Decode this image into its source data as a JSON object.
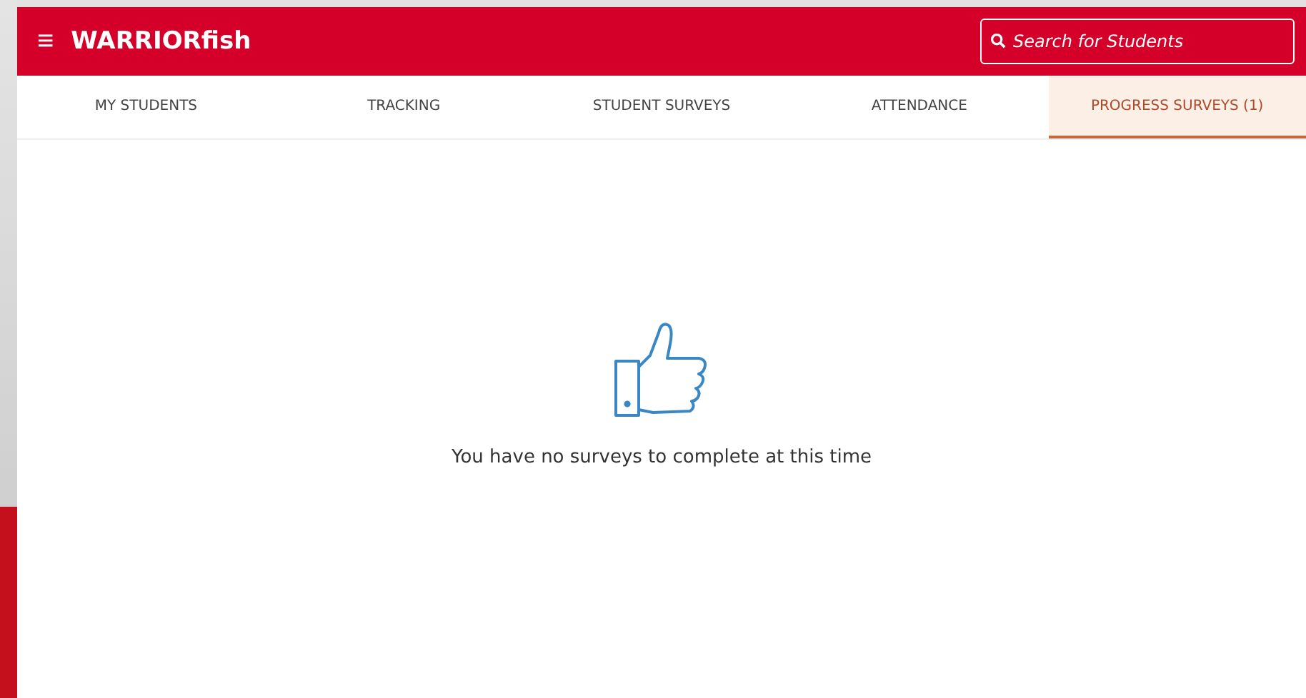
{
  "header": {
    "menu_icon": "≡",
    "title": "WARRIORfish",
    "search": {
      "placeholder": "Search for Students"
    }
  },
  "tabs": [
    {
      "label": "MY STUDENTS",
      "selected": false
    },
    {
      "label": "TRACKING",
      "selected": false
    },
    {
      "label": "STUDENT SURVEYS",
      "selected": false
    },
    {
      "label": "ATTENDANCE",
      "selected": false
    },
    {
      "label": "PROGRESS SURVEYS (1)",
      "selected": true
    }
  ],
  "empty_state": {
    "message": "You have no surveys to complete at this time"
  }
}
